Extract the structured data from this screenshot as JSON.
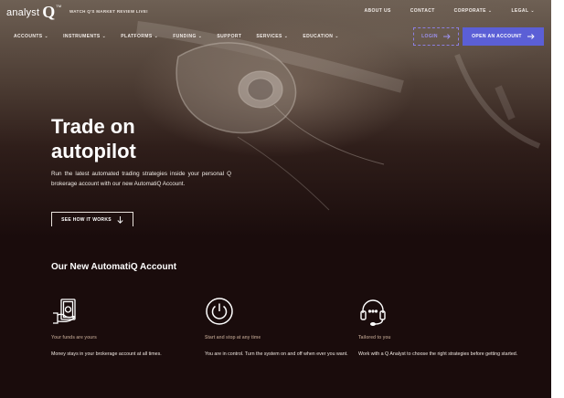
{
  "brand": {
    "name": "analyst",
    "mark": "Q",
    "tm": "TM",
    "tagline": "WATCH Q'S MARKET REVIEW LIVE!"
  },
  "utility_nav": [
    {
      "label": "ABOUT US",
      "dropdown": false
    },
    {
      "label": "CONTACT",
      "dropdown": false
    },
    {
      "label": "CORPORATE",
      "dropdown": true
    },
    {
      "label": "LEGAL",
      "dropdown": true
    }
  ],
  "main_nav": [
    {
      "label": "ACCOUNTS",
      "dropdown": true
    },
    {
      "label": "INSTRUMENTS",
      "dropdown": true
    },
    {
      "label": "PLATFORMS",
      "dropdown": true
    },
    {
      "label": "FUNDING",
      "dropdown": true
    },
    {
      "label": "SUPPORT",
      "dropdown": false
    },
    {
      "label": "SERVICES",
      "dropdown": true
    },
    {
      "label": "EDUCATION",
      "dropdown": true
    }
  ],
  "actions": {
    "login_label": "LOGIN",
    "open_account_label": "OPEN AN ACCOUNT"
  },
  "hero": {
    "title_line1": "Trade on",
    "title_line2": "autopilot",
    "copy": "Run the latest automated trading strategies inside your personal Q brokerage account with our new AutomatiQ Account.",
    "cta_label": "SEE HOW IT WORKS"
  },
  "section": {
    "title": "Our New AutomatiQ Account"
  },
  "features": [
    {
      "icon": "money-hand-icon",
      "heading": "Your funds are yours",
      "text": "Money stays in your brokerage account at all times."
    },
    {
      "icon": "power-icon",
      "heading": "Start and stop at any time",
      "text": "You are in control. Turn the system on and off when ever you want."
    },
    {
      "icon": "headset-icon",
      "heading": "Tailored to you",
      "text": "Work with a Q Analyst to choose the right strategies before getting started."
    }
  ],
  "colors": {
    "accent": "#5b5fd6",
    "login_border": "#8c7fe0",
    "feature_heading": "#a08878",
    "background_dark": "#1a0c0c"
  }
}
